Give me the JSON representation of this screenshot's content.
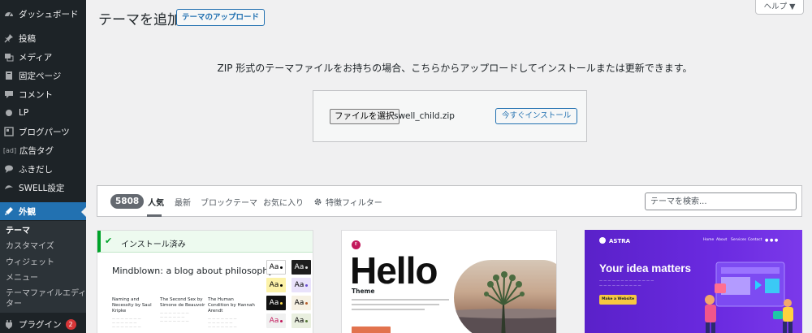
{
  "sidebar": {
    "items": [
      {
        "label": "ダッシュボード",
        "icon": "dashboard-icon"
      },
      {
        "label": "投稿",
        "icon": "pin-icon"
      },
      {
        "label": "メディア",
        "icon": "media-icon"
      },
      {
        "label": "固定ページ",
        "icon": "page-icon"
      },
      {
        "label": "コメント",
        "icon": "comment-icon"
      },
      {
        "label": "LP",
        "icon": "lp-icon"
      },
      {
        "label": "ブログパーツ",
        "icon": "blog-parts-icon"
      },
      {
        "label": "広告タグ",
        "icon": "ad-icon",
        "glyph": "[ad]"
      },
      {
        "label": "ふきだし",
        "icon": "speech-bubble-icon"
      },
      {
        "label": "SWELL設定",
        "icon": "swell-icon"
      },
      {
        "label": "外観",
        "icon": "appearance-icon"
      },
      {
        "label": "プラグイン",
        "icon": "plugin-icon",
        "badge": "2"
      }
    ],
    "submenu": [
      "テーマ",
      "カスタマイズ",
      "ウィジェット",
      "メニュー",
      "テーマファイルエディ",
      "ター"
    ]
  },
  "header": {
    "title": "テーマを追加",
    "upload_button": "テーマのアップロード",
    "help_button": "ヘルプ ▼"
  },
  "upload": {
    "description": "ZIP 形式のテーマファイルをお持ちの場合、こちらからアップロードしてインストールまたは更新できます。",
    "file_button": "ファイルを選択",
    "file_name": "swell_child.zip",
    "install_button": "今すぐインストール"
  },
  "filter": {
    "count": "5808",
    "tabs": [
      "人気",
      "最新",
      "ブロックテーマ",
      "お気に入り"
    ],
    "feature_filter": "特徴フィルター",
    "search_placeholder": "テーマを検索..."
  },
  "themes": {
    "card1": {
      "installed": "インストール済み",
      "title": "Mindblown: a blog about philosophy.",
      "posts": [
        {
          "title": "Naming and Necessity by Saul Kripke"
        },
        {
          "title": "The Second Sex by Simone de Beauvoir"
        },
        {
          "title": "The Human Condition by Hannah Arendt"
        }
      ],
      "swatch_label": "Aa"
    },
    "card2": {
      "logo": "E",
      "title": "Hello",
      "subtitle": "Theme"
    },
    "card3": {
      "logo": "ASTRA",
      "nav": [
        "Home",
        "About",
        "Services",
        "Contact"
      ],
      "heading": "Your idea matters",
      "button": "Make a Website"
    }
  },
  "colors": {
    "sidebar_bg": "#1d2327",
    "accent": "#2271b1",
    "success": "#00a32a",
    "astra_purple": "#6a2ae0"
  }
}
